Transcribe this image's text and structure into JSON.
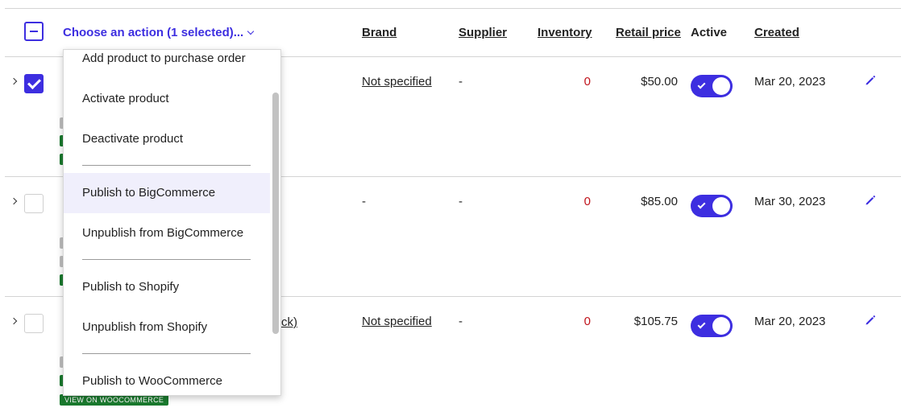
{
  "header": {
    "action_label": "Choose an action (1 selected)...",
    "brand": "Brand",
    "supplier": "Supplier",
    "inventory": "Inventory",
    "retail_price": "Retail price",
    "active": "Active",
    "created": "Created"
  },
  "rows": [
    {
      "selected": true,
      "brand": "Not specified",
      "supplier": "-",
      "inventory": "0",
      "price": "$50.00",
      "active": true,
      "created": "Mar 20, 2023"
    },
    {
      "selected": false,
      "brand": "-",
      "supplier": "-",
      "inventory": "0",
      "price": "$85.00",
      "active": true,
      "created": "Mar 30, 2023"
    },
    {
      "selected": false,
      "name_fragment": "ck)",
      "brand": "Not specified",
      "supplier": "-",
      "inventory": "0",
      "price": "$105.75",
      "active": true,
      "created": "Mar 20, 2023",
      "badge": "VIEW ON WOOCOMMERCE"
    }
  ],
  "dropdown": {
    "items": [
      "Add product to purchase order",
      "Activate product",
      "Deactivate product",
      "Publish to BigCommerce",
      "Unpublish from BigCommerce",
      "Publish to Shopify",
      "Unpublish from Shopify",
      "Publish to WooCommerce"
    ],
    "highlighted": "Publish to BigCommerce"
  },
  "colors": {
    "accent": "#3d2ee0",
    "inventory_zero": "#c0141c",
    "badge_green": "#1a7a2e",
    "hover_bg": "#f0effc"
  },
  "icons": {
    "edit": "pencil-icon",
    "expand": "chevron-right-icon",
    "dropdown": "chevron-down-icon"
  }
}
